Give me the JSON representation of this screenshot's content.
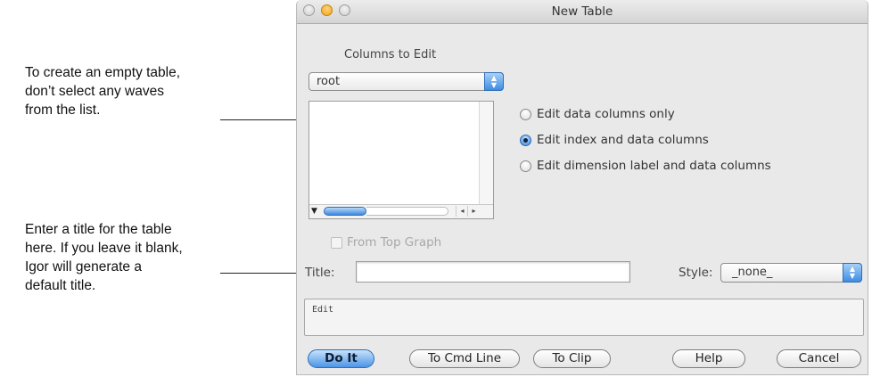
{
  "callouts": {
    "empty_table": [
      "To create an empty table,",
      "don’t select any waves",
      "from the list."
    ],
    "title_hint": [
      "Enter a title for the table",
      "here. If you leave it blank,",
      "Igor will generate a",
      "default title."
    ]
  },
  "window": {
    "title": "New Table",
    "columns_label": "Columns to Edit",
    "folder_popup": {
      "value": "root"
    },
    "radios": [
      {
        "label": "Edit data columns only",
        "selected": false
      },
      {
        "label": "Edit index and data columns",
        "selected": true
      },
      {
        "label": "Edit dimension label and data columns",
        "selected": false
      }
    ],
    "from_top_graph": {
      "label": "From Top Graph",
      "checked": false,
      "enabled": false
    },
    "title_label": "Title:",
    "title_value": "",
    "style_label": "Style:",
    "style_popup": {
      "value": "_none_"
    },
    "command_text": "Edit",
    "buttons": {
      "do_it": "Do It",
      "to_cmd_line": "To Cmd Line",
      "to_clip": "To Clip",
      "help": "Help",
      "cancel": "Cancel"
    }
  },
  "colors": {
    "accent": "#3d8de3",
    "window_bg": "#e9e9e9",
    "disabled_text": "#a9a9a9"
  }
}
